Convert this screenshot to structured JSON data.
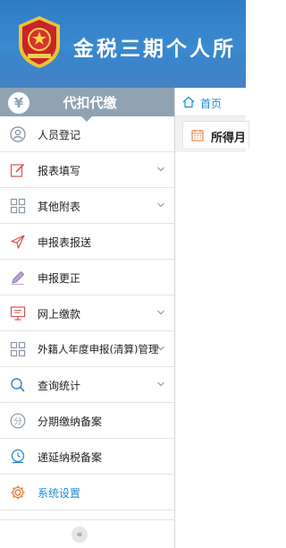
{
  "header": {
    "app_title": "金税三期个人所",
    "emblem_icon": "tax-emblem-icon"
  },
  "sidebar": {
    "title": "代扣代缴",
    "title_icon": "yen-icon",
    "items": [
      {
        "label": "人员登记",
        "icon": "person-icon",
        "expandable": false
      },
      {
        "label": "报表填写",
        "icon": "edit-icon",
        "expandable": true
      },
      {
        "label": "其他附表",
        "icon": "grid-icon",
        "expandable": true
      },
      {
        "label": "申报表报送",
        "icon": "send-icon",
        "expandable": false
      },
      {
        "label": "申报更正",
        "icon": "pencil-icon",
        "expandable": false
      },
      {
        "label": "网上缴款",
        "icon": "monitor-icon",
        "expandable": true
      },
      {
        "label": "外籍人年度申报(清算)管理",
        "icon": "grid-icon",
        "expandable": true
      },
      {
        "label": "查询统计",
        "icon": "search-icon",
        "expandable": true
      },
      {
        "label": "分期缴纳备案",
        "icon": "installment-icon",
        "expandable": false
      },
      {
        "label": "递延纳税备案",
        "icon": "deferral-icon",
        "expandable": false
      },
      {
        "label": "系统设置",
        "icon": "gear-icon",
        "expandable": false
      }
    ],
    "collapse_glyph": "«"
  },
  "main": {
    "breadcrumb_home": "首页",
    "tab_label": "所得月"
  },
  "colors": {
    "header_blue": "#3a86cd",
    "sidebar_header": "#8fa3b3",
    "accent_blue": "#1a8cd8",
    "settings_orange": "#e8803c"
  }
}
